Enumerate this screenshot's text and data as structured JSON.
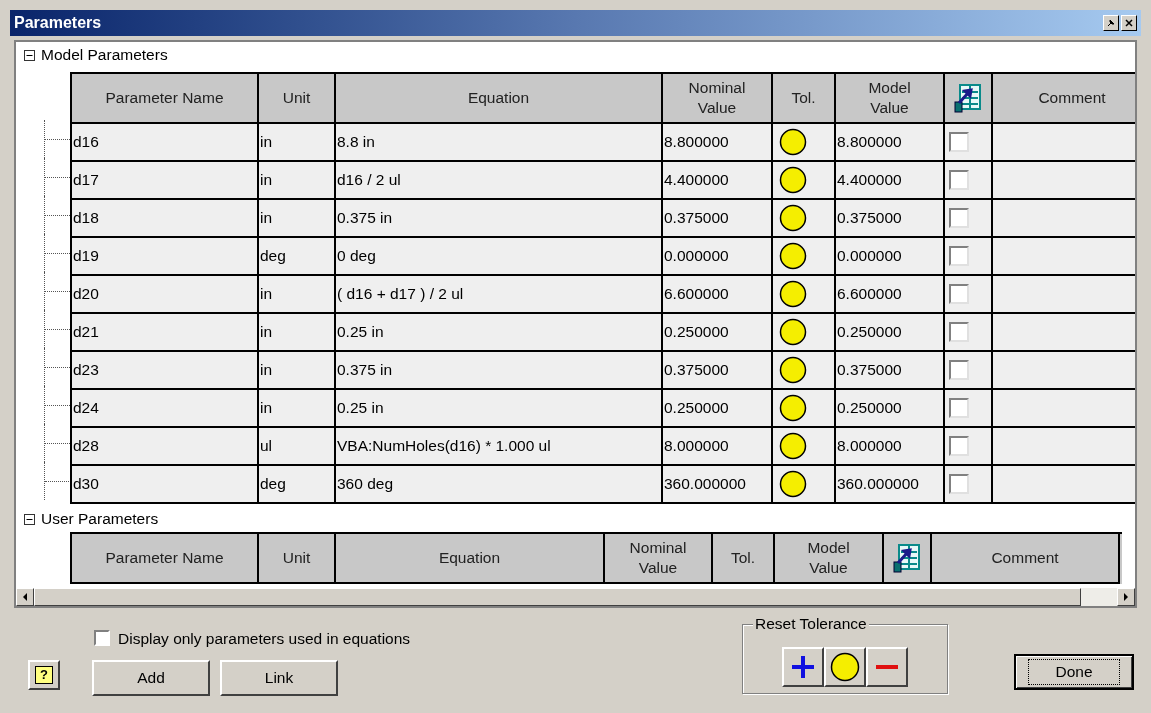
{
  "window": {
    "title": "Parameters"
  },
  "model_parameters": {
    "label": "Model Parameters",
    "expanded": true,
    "columns": [
      {
        "kind": "text",
        "label": "Parameter Name"
      },
      {
        "kind": "text",
        "label": "Unit"
      },
      {
        "kind": "text",
        "label": "Equation"
      },
      {
        "kind": "text",
        "label": "Nominal Value"
      },
      {
        "kind": "text",
        "label": "Tol."
      },
      {
        "kind": "text",
        "label": "Model Value"
      },
      {
        "kind": "icon"
      },
      {
        "kind": "text",
        "label": "Comment"
      }
    ],
    "rows": [
      {
        "name": "d16",
        "unit": "in",
        "equation": "8.8 in",
        "nominal": "8.800000",
        "model_value": "8.800000",
        "exported": false
      },
      {
        "name": "d17",
        "unit": "in",
        "equation": "d16 / 2 ul",
        "nominal": "4.400000",
        "model_value": "4.400000",
        "exported": false
      },
      {
        "name": "d18",
        "unit": "in",
        "equation": "0.375 in",
        "nominal": "0.375000",
        "model_value": "0.375000",
        "exported": false
      },
      {
        "name": "d19",
        "unit": "deg",
        "equation": "0 deg",
        "nominal": "0.000000",
        "model_value": "0.000000",
        "exported": false
      },
      {
        "name": "d20",
        "unit": "in",
        "equation": "( d16 + d17 ) / 2 ul",
        "nominal": "6.600000",
        "model_value": "6.600000",
        "exported": false
      },
      {
        "name": "d21",
        "unit": "in",
        "equation": "0.25 in",
        "nominal": "0.250000",
        "model_value": "0.250000",
        "exported": false
      },
      {
        "name": "d23",
        "unit": "in",
        "equation": "0.375 in",
        "nominal": "0.375000",
        "model_value": "0.375000",
        "exported": false
      },
      {
        "name": "d24",
        "unit": "in",
        "equation": "0.25 in",
        "nominal": "0.250000",
        "model_value": "0.250000",
        "exported": false
      },
      {
        "name": "d28",
        "unit": "ul",
        "equation": "VBA:NumHoles(d16) * 1.000 ul",
        "nominal": "8.000000",
        "model_value": "8.000000",
        "exported": false
      },
      {
        "name": "d30",
        "unit": "deg",
        "equation": "360 deg",
        "nominal": "360.000000",
        "model_value": "360.000000",
        "exported": false
      }
    ]
  },
  "user_parameters": {
    "label": "User Parameters",
    "expanded": true,
    "columns": [
      {
        "kind": "text",
        "label": "Parameter Name"
      },
      {
        "kind": "text",
        "label": "Unit"
      },
      {
        "kind": "text",
        "label": "Equation"
      },
      {
        "kind": "text",
        "label": "Nominal Value"
      },
      {
        "kind": "text",
        "label": "Tol."
      },
      {
        "kind": "text",
        "label": "Model Value"
      },
      {
        "kind": "icon"
      },
      {
        "kind": "text",
        "label": "Comment"
      }
    ]
  },
  "display_only_used": {
    "label": "Display only parameters used in equations",
    "checked": false
  },
  "help_button": "?",
  "buttons": [
    "Add",
    "Link"
  ],
  "reset_tolerance": {
    "label": "Reset Tolerance"
  },
  "done_button": "Done"
}
